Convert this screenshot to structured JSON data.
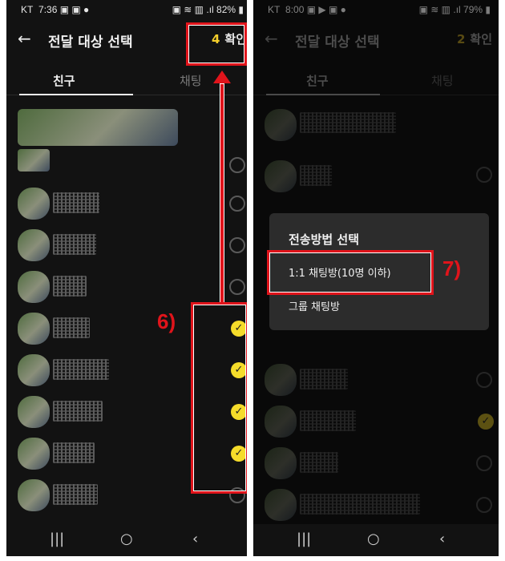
{
  "left": {
    "status": {
      "carrier": "KT",
      "time": "7:36",
      "battery": "82%"
    },
    "header": {
      "title": "전달 대상 선택",
      "count": "4",
      "confirm": "확인"
    },
    "tabs": [
      "친구",
      "채팅"
    ],
    "annotation": "6)"
  },
  "right": {
    "status": {
      "carrier": "KT",
      "time": "8:00",
      "battery": "79%"
    },
    "header": {
      "title": "전달 대상 선택",
      "count": "2",
      "confirm": "확인"
    },
    "tabs": [
      "친구",
      "채팅"
    ],
    "dialog": {
      "title": "전송방법 선택",
      "option1": "1:1 채팅방(10명 이하)",
      "option2": "그룹 채팅방"
    },
    "annotation": "7)"
  },
  "icons": {
    "back": "back-arrow-icon",
    "check": "checkmark-icon",
    "recent": "recent-apps-icon",
    "home": "home-icon",
    "nav_back": "nav-back-icon"
  },
  "colors": {
    "accent": "#f5cf2b",
    "annotation": "#e0141b",
    "background": "#121212"
  }
}
